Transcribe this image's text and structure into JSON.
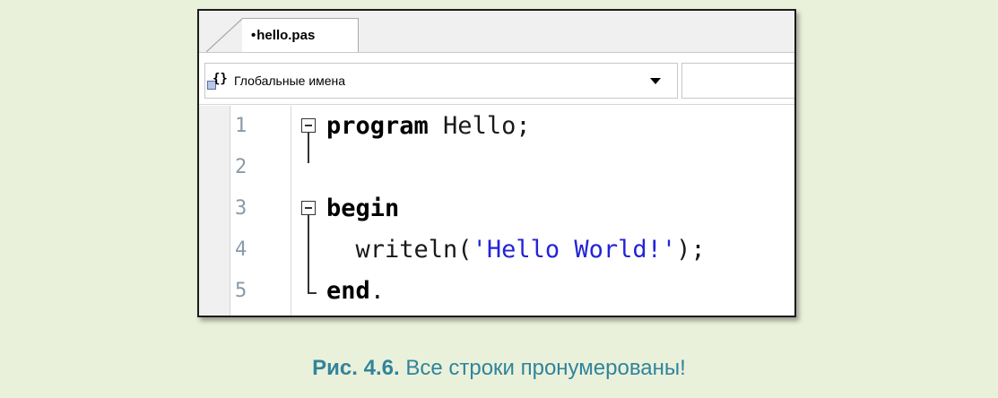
{
  "tab": {
    "dot": "•",
    "filename": "hello.pas"
  },
  "toolbar": {
    "scope_label": "Глобальные имена",
    "scope_icon": "braces-icon"
  },
  "editor": {
    "lines": [
      {
        "number": "1",
        "kw": "program",
        "rest": " Hello;"
      },
      {
        "number": "2"
      },
      {
        "number": "3",
        "kw": "begin"
      },
      {
        "number": "4",
        "indent": "  ",
        "func": "writeln(",
        "str": "'Hello World!'",
        "tail": ");"
      },
      {
        "number": "5",
        "kw": "end",
        "tail": "."
      }
    ]
  },
  "caption": {
    "fig": "Рис. 4.6.",
    "text": " Все строки пронумерованы!"
  },
  "colors": {
    "background": "#eaf1db",
    "caption": "#31849b",
    "string": "#2323d8",
    "line_number": "#8a9aa8"
  }
}
